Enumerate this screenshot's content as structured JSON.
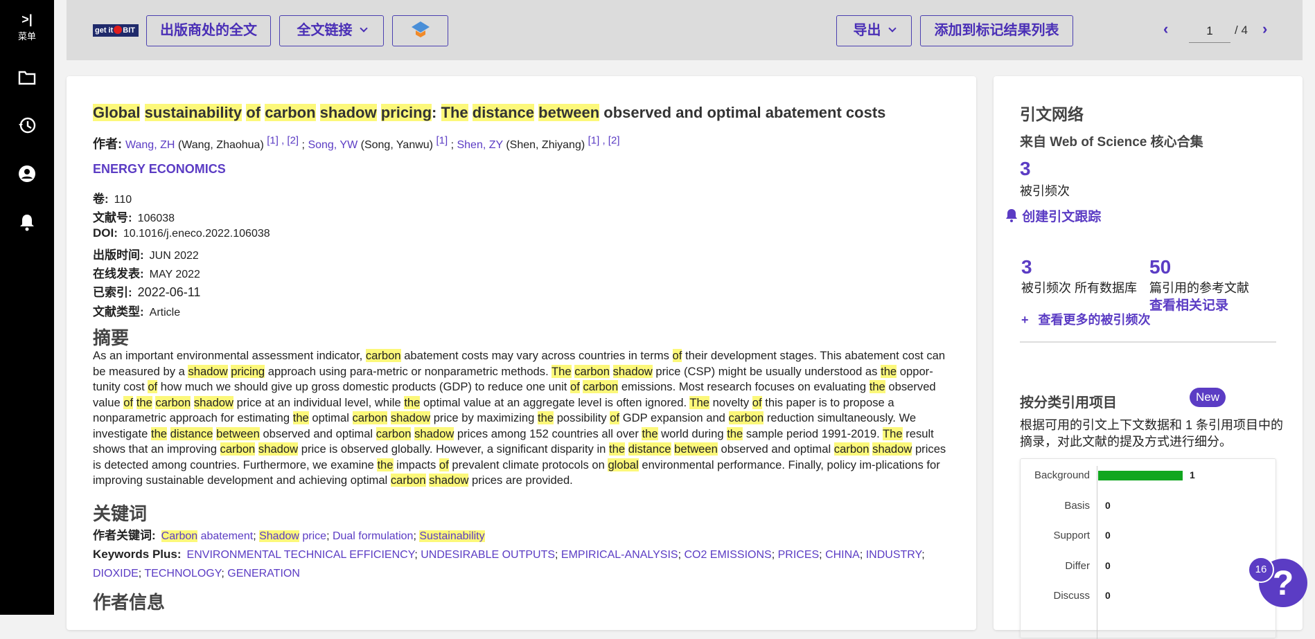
{
  "rail": {
    "menu_label": "菜单",
    "menu_glyph": ">|"
  },
  "toolbar": {
    "logo_text": "get it",
    "logo_text2": "BIT",
    "btn_publisher": "出版商处的全文",
    "btn_fulltext": "全文链接",
    "btn_export": "导出",
    "btn_add_marked": "添加到标记结果列表",
    "pager_current": "1",
    "pager_total": "/ 4"
  },
  "record": {
    "title_parts": [
      {
        "t": "Global",
        "h": true
      },
      {
        "t": " ",
        "h": false
      },
      {
        "t": "sustainability",
        "h": true
      },
      {
        "t": " ",
        "h": false
      },
      {
        "t": "of",
        "h": true
      },
      {
        "t": " ",
        "h": false
      },
      {
        "t": "carbon",
        "h": true
      },
      {
        "t": " ",
        "h": false
      },
      {
        "t": "shadow",
        "h": true
      },
      {
        "t": " ",
        "h": false
      },
      {
        "t": "pricing",
        "h": true
      },
      {
        "t": ": ",
        "h": false
      },
      {
        "t": "The",
        "h": true
      },
      {
        "t": " ",
        "h": false
      },
      {
        "t": "distance",
        "h": true
      },
      {
        "t": " ",
        "h": false
      },
      {
        "t": "between",
        "h": true
      },
      {
        "t": " observed and optimal abatement costs",
        "h": false
      }
    ],
    "authors_label": "作者:",
    "authors": [
      {
        "short": "Wang, ZH",
        "full": "(Wang, Zhaohua)",
        "refs": "[1] , [2]"
      },
      {
        "short": "Song, YW",
        "full": "(Song, Yanwu)",
        "refs": "[1]"
      },
      {
        "short": "Shen, ZY",
        "full": "(Shen, Zhiyang)",
        "refs": "[1] , [2]"
      }
    ],
    "journal": "ENERGY ECONOMICS",
    "meta": [
      {
        "k": "卷:",
        "v": "110"
      },
      {
        "k": "文献号:",
        "v": "106038"
      },
      {
        "k": "DOI:",
        "v": "10.1016/j.eneco.2022.106038"
      },
      {
        "k": "出版时间:",
        "v": "JUN 2022"
      },
      {
        "k": "在线发表:",
        "v": "MAY 2022"
      },
      {
        "k": "已索引:",
        "v": "2022-06-11"
      },
      {
        "k": "文献类型:",
        "v": "Article"
      }
    ],
    "abstract_heading": "摘要",
    "abstract_parts": [
      {
        "t": "As an important environmental assessment indicator, ",
        "h": false
      },
      {
        "t": "carbon",
        "h": true
      },
      {
        "t": " abatement costs may vary across countries in terms ",
        "h": false
      },
      {
        "t": "of",
        "h": true
      },
      {
        "t": " their development stages. This abatement cost can be measured by a ",
        "h": false
      },
      {
        "t": "shadow",
        "h": true
      },
      {
        "t": " ",
        "h": false
      },
      {
        "t": "pricing",
        "h": true
      },
      {
        "t": " approach using para-metric or nonparametric methods. ",
        "h": false
      },
      {
        "t": "The",
        "h": true
      },
      {
        "t": " ",
        "h": false
      },
      {
        "t": "carbon",
        "h": true
      },
      {
        "t": " ",
        "h": false
      },
      {
        "t": "shadow",
        "h": true
      },
      {
        "t": " price (CSP) might be usually understood as ",
        "h": false
      },
      {
        "t": "the",
        "h": true
      },
      {
        "t": " oppor-tunity cost ",
        "h": false
      },
      {
        "t": "of",
        "h": true
      },
      {
        "t": " how much we should give up gross domestic products (GDP) to reduce one unit ",
        "h": false
      },
      {
        "t": "of",
        "h": true
      },
      {
        "t": " ",
        "h": false
      },
      {
        "t": "carbon",
        "h": true
      },
      {
        "t": " emissions. Most research focuses on evaluating ",
        "h": false
      },
      {
        "t": "the",
        "h": true
      },
      {
        "t": " observed value ",
        "h": false
      },
      {
        "t": "of",
        "h": true
      },
      {
        "t": " ",
        "h": false
      },
      {
        "t": "the",
        "h": true
      },
      {
        "t": " ",
        "h": false
      },
      {
        "t": "carbon",
        "h": true
      },
      {
        "t": " ",
        "h": false
      },
      {
        "t": "shadow",
        "h": true
      },
      {
        "t": " price at an individual level, while ",
        "h": false
      },
      {
        "t": "the",
        "h": true
      },
      {
        "t": " optimal value at an aggregate level is often ignored. ",
        "h": false
      },
      {
        "t": "The",
        "h": true
      },
      {
        "t": " novelty ",
        "h": false
      },
      {
        "t": "of",
        "h": true
      },
      {
        "t": " this paper is to propose a nonparametric approach for estimating ",
        "h": false
      },
      {
        "t": "the",
        "h": true
      },
      {
        "t": " optimal ",
        "h": false
      },
      {
        "t": "carbon",
        "h": true
      },
      {
        "t": " ",
        "h": false
      },
      {
        "t": "shadow",
        "h": true
      },
      {
        "t": " price by maximizing ",
        "h": false
      },
      {
        "t": "the",
        "h": true
      },
      {
        "t": " possibility ",
        "h": false
      },
      {
        "t": "of",
        "h": true
      },
      {
        "t": " GDP expansion and ",
        "h": false
      },
      {
        "t": "carbon",
        "h": true
      },
      {
        "t": " reduction simultaneously. We investigate ",
        "h": false
      },
      {
        "t": "the",
        "h": true
      },
      {
        "t": " ",
        "h": false
      },
      {
        "t": "distance",
        "h": true
      },
      {
        "t": " ",
        "h": false
      },
      {
        "t": "between",
        "h": true
      },
      {
        "t": " observed and optimal ",
        "h": false
      },
      {
        "t": "carbon",
        "h": true
      },
      {
        "t": " ",
        "h": false
      },
      {
        "t": "shadow",
        "h": true
      },
      {
        "t": " prices among 152 countries all over ",
        "h": false
      },
      {
        "t": "the",
        "h": true
      },
      {
        "t": " world during ",
        "h": false
      },
      {
        "t": "the",
        "h": true
      },
      {
        "t": " sample period 1991-2019. ",
        "h": false
      },
      {
        "t": "The",
        "h": true
      },
      {
        "t": " result shows that an improving ",
        "h": false
      },
      {
        "t": "carbon",
        "h": true
      },
      {
        "t": " ",
        "h": false
      },
      {
        "t": "shadow",
        "h": true
      },
      {
        "t": " price is observed globally. However, a significant disparity in ",
        "h": false
      },
      {
        "t": "the",
        "h": true
      },
      {
        "t": " ",
        "h": false
      },
      {
        "t": "distance",
        "h": true
      },
      {
        "t": " ",
        "h": false
      },
      {
        "t": "between",
        "h": true
      },
      {
        "t": " observed and optimal ",
        "h": false
      },
      {
        "t": "carbon",
        "h": true
      },
      {
        "t": " ",
        "h": false
      },
      {
        "t": "shadow",
        "h": true
      },
      {
        "t": " prices is detected among countries. Furthermore, we examine ",
        "h": false
      },
      {
        "t": "the",
        "h": true
      },
      {
        "t": " impacts ",
        "h": false
      },
      {
        "t": "of",
        "h": true
      },
      {
        "t": " prevalent climate protocols on ",
        "h": false
      },
      {
        "t": "global",
        "h": true
      },
      {
        "t": " environmental performance. Finally, policy im-plications for improving sustainable development and achieving optimal ",
        "h": false
      },
      {
        "t": "carbon",
        "h": true
      },
      {
        "t": " ",
        "h": false
      },
      {
        "t": "shadow",
        "h": true
      },
      {
        "t": " prices are provided.",
        "h": false
      }
    ],
    "keywords_heading": "关键词",
    "author_kw_label": "作者关键词:",
    "author_keywords": [
      [
        {
          "t": "Carbon",
          "h": true
        },
        {
          "t": " abatement",
          "h": false
        }
      ],
      [
        {
          "t": "Shadow",
          "h": true
        },
        {
          "t": " price",
          "h": false
        }
      ],
      [
        {
          "t": "Dual formulation",
          "h": false
        }
      ],
      [
        {
          "t": "Sustainability",
          "h": true
        }
      ]
    ],
    "kw_plus_label": "Keywords Plus:",
    "keywords_plus": [
      "ENVIRONMENTAL TECHNICAL EFFICIENCY",
      "UNDESIRABLE OUTPUTS",
      "EMPIRICAL-ANALYSIS",
      "CO2 EMISSIONS",
      "PRICES",
      "CHINA",
      "INDUSTRY",
      "DIOXIDE",
      "TECHNOLOGY",
      "GENERATION"
    ],
    "author_info_heading": "作者信息"
  },
  "side": {
    "heading": "引文网络",
    "source": "来自 Web of Science 核心合集",
    "times_cited": "3",
    "times_cited_label": "被引频次",
    "create_alert": "创建引文跟踪",
    "all_db_cited": "3",
    "all_db_label": "被引频次 所有数据库",
    "refs_count": "50",
    "refs_label": "篇引用的参考文献",
    "related_link": "查看相关记录",
    "more_cited": "查看更多的被引频次",
    "plus": "+",
    "classify_heading": "按分类引用项目",
    "new_badge": "New",
    "classify_desc": "根据可用的引文上下文数据和 1 条引用项目中的摘录，对此文献的提及方式进行细分。"
  },
  "chart_data": {
    "type": "bar",
    "orientation": "horizontal",
    "categories": [
      "Background",
      "Basis",
      "Support",
      "Differ",
      "Discuss"
    ],
    "values": [
      1,
      0,
      0,
      0,
      0
    ],
    "bar_color": "#11a61f"
  },
  "help": {
    "count": "16",
    "glyph": "?"
  },
  "colors": {
    "accent": "#5b3cc4",
    "highlight": "#fcf87a",
    "rail": "#000000",
    "toolbar": "#dcdcdc"
  }
}
